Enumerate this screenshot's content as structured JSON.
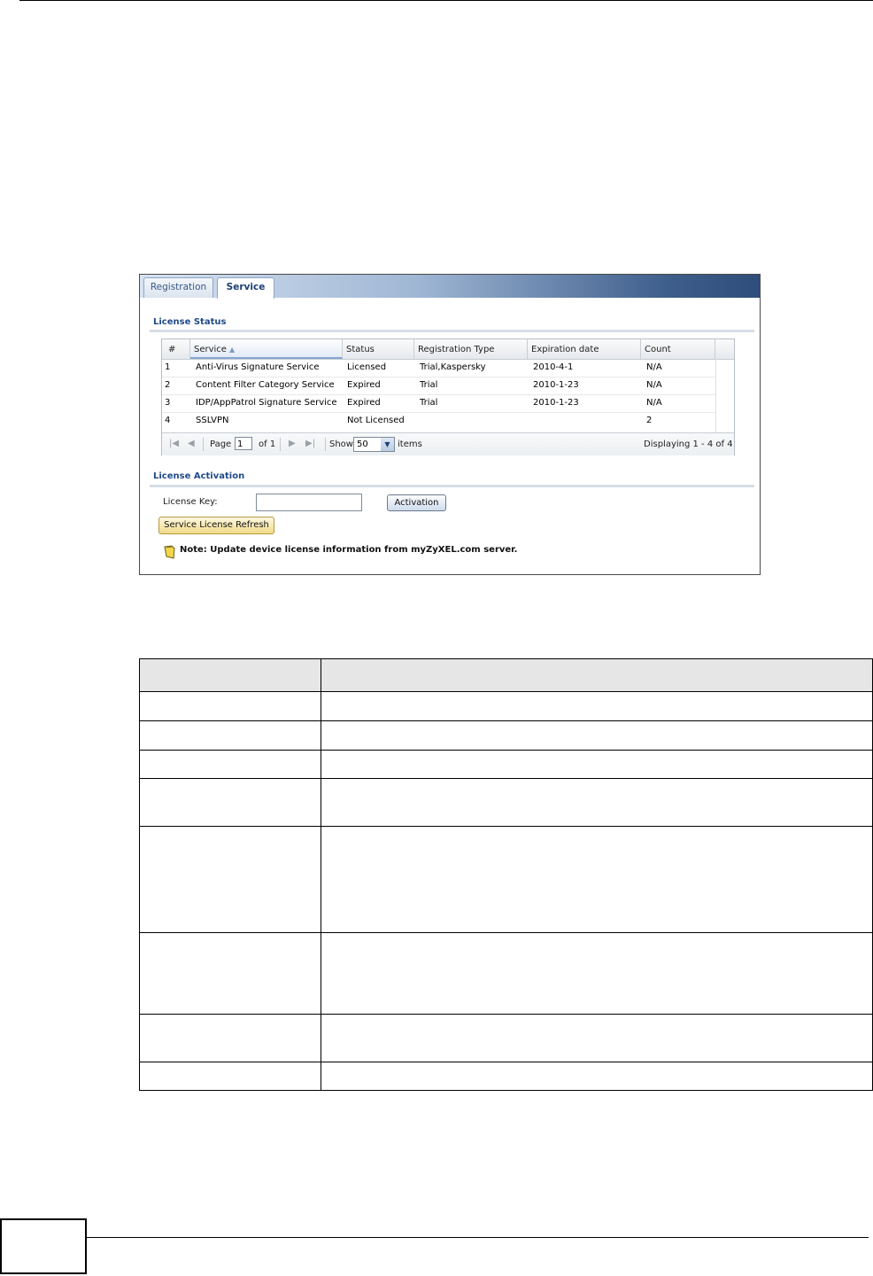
{
  "tabs": [
    {
      "label": "Registration",
      "active": false
    },
    {
      "label": "Service",
      "active": true
    }
  ],
  "license_status": {
    "title": "License Status",
    "columns": [
      "#",
      "Service",
      "Status",
      "Registration Type",
      "Expiration date",
      "Count"
    ],
    "sorted_column": "Service",
    "rows": [
      {
        "num": "1",
        "service": "Anti-Virus Signature Service",
        "status": "Licensed",
        "reg_type": "Trial,Kaspersky",
        "expiration": "2010-4-1",
        "count": "N/A"
      },
      {
        "num": "2",
        "service": "Content Filter Category Service",
        "status": "Expired",
        "reg_type": "Trial",
        "expiration": "2010-1-23",
        "count": "N/A"
      },
      {
        "num": "3",
        "service": "IDP/AppPatrol Signature Service",
        "status": "Expired",
        "reg_type": "Trial",
        "expiration": "2010-1-23",
        "count": "N/A"
      },
      {
        "num": "4",
        "service": "SSLVPN",
        "status": "Not Licensed",
        "reg_type": "",
        "expiration": "",
        "count": "2"
      }
    ],
    "pager": {
      "page_label": "Page",
      "page_value": "1",
      "of_label": "of 1",
      "show_label": "Show",
      "show_value": "50",
      "items_label": "items",
      "displaying": "Displaying 1 - 4 of 4"
    }
  },
  "license_activation": {
    "title": "License Activation",
    "key_label": "License Key:",
    "key_value": "",
    "activation_button": "Activation",
    "refresh_button": "Service License Refresh",
    "note": "Note: Update device license information from myZyXEL.com server."
  },
  "colors": {
    "section_title": "#1f4a8a",
    "tab_bar_dark": "#2f4d7a",
    "refresh_button": "#f0d98a"
  }
}
